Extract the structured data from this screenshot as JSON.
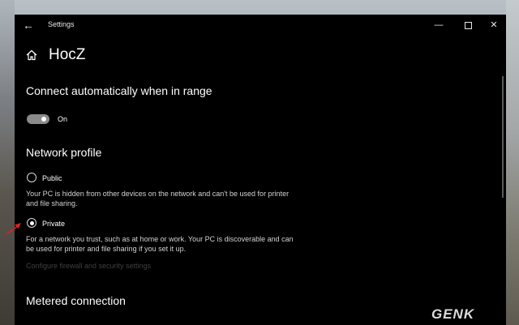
{
  "window": {
    "title": "Settings"
  },
  "page": {
    "title": "HocZ"
  },
  "connect_auto": {
    "heading": "Connect automatically when in range",
    "toggle_state": "On",
    "toggle_on": true
  },
  "network_profile": {
    "heading": "Network profile",
    "selected": "Private",
    "options": [
      {
        "label": "Public",
        "description": "Your PC is hidden from other devices on the network and can't be used for printer and file sharing."
      },
      {
        "label": "Private",
        "description": "For a network you trust, such as at home or work. Your PC is discoverable and can be used for printer and file sharing if you set it up."
      }
    ],
    "link": "Configure firewall and security settings"
  },
  "metered": {
    "heading": "Metered connection"
  },
  "watermark": "GENK",
  "colors": {
    "window_bg": "#000000",
    "text": "#ffffff",
    "secondary_text": "#d2d2d2",
    "disabled_link": "#3f3f3f",
    "toggle_track": "#8a8a8a",
    "annotation_arrow": "#e02020"
  },
  "icons": {
    "back": "back-arrow-icon",
    "home": "home-icon",
    "minimize": "minimize-icon",
    "maximize": "maximize-icon",
    "close": "close-icon"
  }
}
